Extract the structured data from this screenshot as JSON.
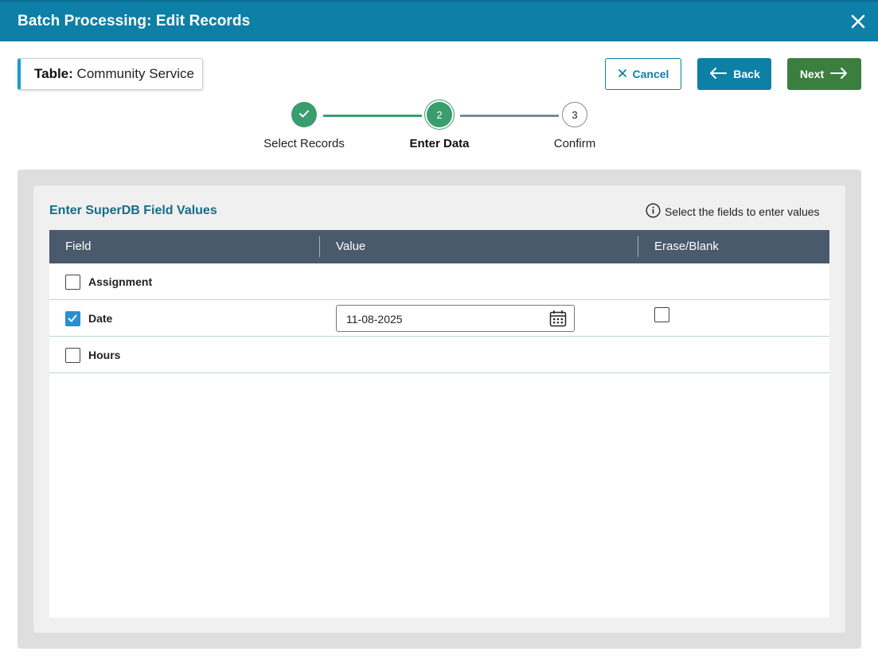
{
  "dialog": {
    "title": "Batch Processing: Edit Records"
  },
  "table_chip": {
    "label": "Table:",
    "value": "Community Service"
  },
  "buttons": {
    "cancel": "Cancel",
    "back": "Back",
    "next": "Next"
  },
  "stepper": {
    "steps": [
      {
        "number": "1",
        "label": "Select Records",
        "state": "complete"
      },
      {
        "number": "2",
        "label": "Enter Data",
        "state": "active"
      },
      {
        "number": "3",
        "label": "Confirm",
        "state": "pending"
      }
    ]
  },
  "section": {
    "title": "Enter SuperDB Field Values",
    "hint": "Select the fields to enter values"
  },
  "grid": {
    "columns": [
      "Field",
      "Value",
      "Erase/Blank"
    ],
    "rows": [
      {
        "field": "Assignment",
        "checked": false,
        "value": "",
        "erase": false
      },
      {
        "field": "Date",
        "checked": true,
        "value": "11-08-2025",
        "erase": false
      },
      {
        "field": "Hours",
        "checked": false,
        "value": "",
        "erase": false
      }
    ]
  },
  "colors": {
    "header": "#0e7fa6",
    "success": "#3a9d6e",
    "next_button": "#3b7f3f",
    "grid_header": "#485a6c"
  }
}
